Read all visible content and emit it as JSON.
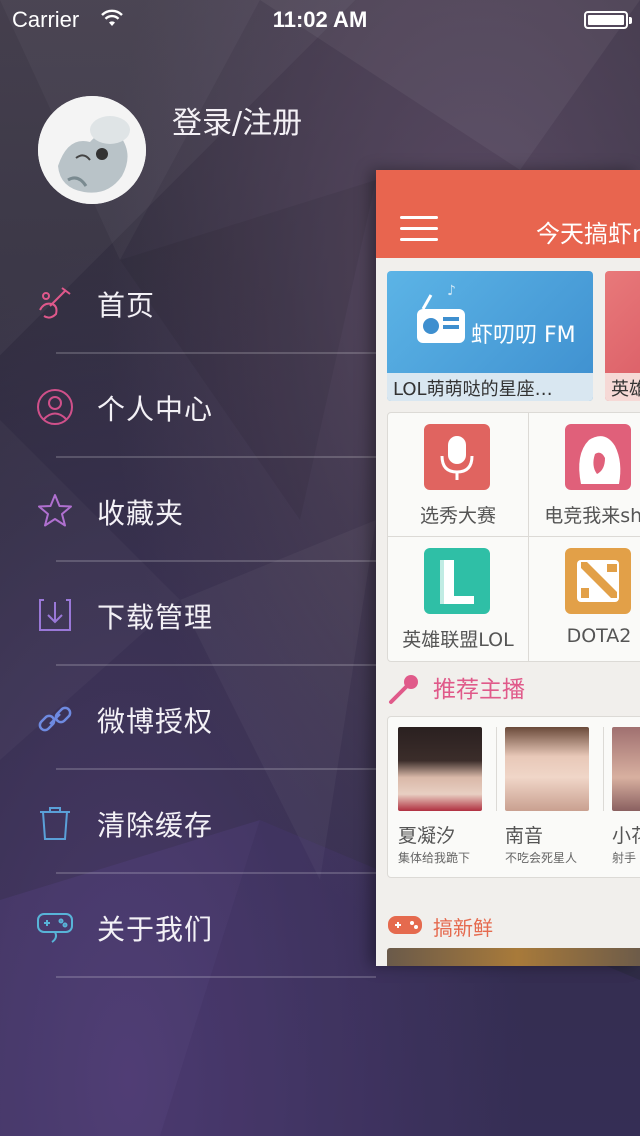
{
  "status_bar": {
    "carrier": "Carrier",
    "time": "11:02 AM"
  },
  "profile": {
    "login_label": "登录/注册"
  },
  "menu": {
    "items": [
      {
        "label": "首页",
        "icon": "music-instrument-icon",
        "color": "#e0588b"
      },
      {
        "label": "个人中心",
        "icon": "person-icon",
        "color": "#d0508a"
      },
      {
        "label": "收藏夹",
        "icon": "star-icon",
        "color": "#b070d0"
      },
      {
        "label": "下载管理",
        "icon": "download-icon",
        "color": "#9a78d8"
      },
      {
        "label": "微博授权",
        "icon": "link-icon",
        "color": "#6e8ae0"
      },
      {
        "label": "清除缓存",
        "icon": "trash-icon",
        "color": "#5aa0d8"
      },
      {
        "label": "关于我们",
        "icon": "gamepad-icon",
        "color": "#58b4d8"
      }
    ]
  },
  "home_panel": {
    "title": "今天搞虾m",
    "banners": [
      {
        "brand": "虾叨叨 FM",
        "caption": "LOL萌萌哒的星座…"
      },
      {
        "caption": "英雄"
      }
    ],
    "categories": [
      {
        "name": "选秀大赛",
        "icon": "microphone-icon",
        "color": "#e06460"
      },
      {
        "name": "电竞我来sho",
        "icon": "girl-silhouette-icon",
        "color": "#e0607a"
      },
      {
        "name": "英雄联盟LOL",
        "icon": "lol-logo-icon",
        "color": "#2fbfa6"
      },
      {
        "name": "DOTA2",
        "icon": "dota-logo-icon",
        "color": "#e2a048"
      }
    ],
    "recommended_title": "推荐主播",
    "anchors": [
      {
        "name": "夏凝汐",
        "desc": "集体给我跪下"
      },
      {
        "name": "南音",
        "desc": "不吃会死星人"
      },
      {
        "name": "小花",
        "desc": "射手"
      }
    ],
    "fresh_title": "搞新鲜"
  }
}
